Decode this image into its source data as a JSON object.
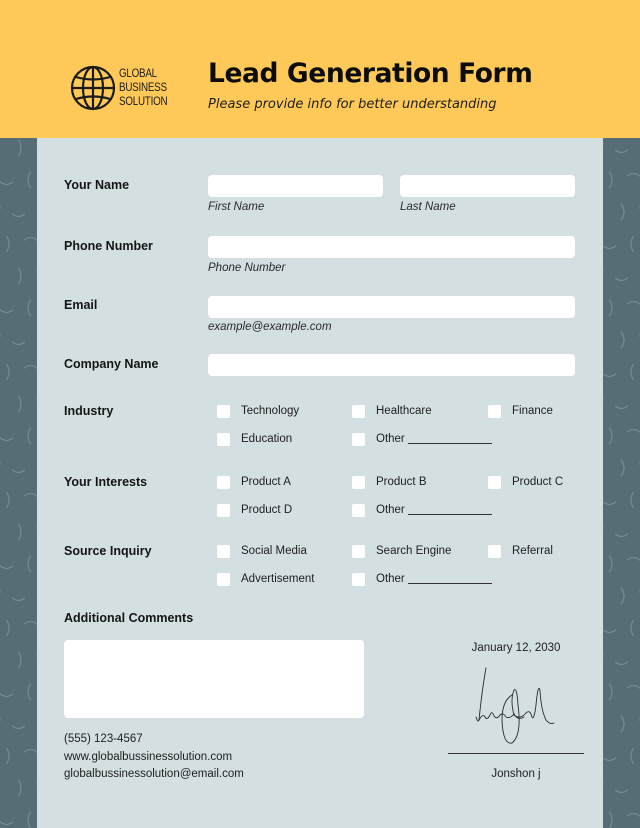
{
  "colors": {
    "header_bg": "#fec958",
    "side_bg": "#566d75",
    "paper_bg": "#d4dfe1",
    "input_bg": "#ffffff"
  },
  "header": {
    "logo_icon": "globe-icon",
    "logo_lines": [
      "GLOBAL",
      "BUSINESS",
      "SOLUTION"
    ],
    "title": "Lead Generation Form",
    "subtitle": "Please provide info for better understanding"
  },
  "form": {
    "name": {
      "label": "Your Name",
      "first": {
        "value": "",
        "hint": "First Name"
      },
      "last": {
        "value": "",
        "hint": "Last Name"
      }
    },
    "phone": {
      "label": "Phone Number",
      "value": "",
      "hint": "Phone Number"
    },
    "email": {
      "label": "Email",
      "value": "",
      "hint": "example@example.com"
    },
    "company": {
      "label": "Company Name",
      "value": ""
    },
    "industry": {
      "label": "Industry",
      "options": [
        {
          "label": "Technology",
          "checked": false
        },
        {
          "label": "Healthcare",
          "checked": false
        },
        {
          "label": "Finance",
          "checked": false
        },
        {
          "label": "Education",
          "checked": false
        },
        {
          "label": "Other",
          "checked": false
        }
      ]
    },
    "interests": {
      "label": "Your Interests",
      "options": [
        {
          "label": "Product A",
          "checked": false
        },
        {
          "label": "Product B",
          "checked": false
        },
        {
          "label": "Product C",
          "checked": false
        },
        {
          "label": "Product D",
          "checked": false
        },
        {
          "label": "Other",
          "checked": false
        }
      ]
    },
    "source": {
      "label": "Source Inquiry",
      "options": [
        {
          "label": "Social Media",
          "checked": false
        },
        {
          "label": "Search Engine",
          "checked": false
        },
        {
          "label": "Referral",
          "checked": false
        },
        {
          "label": "Advertisement",
          "checked": false
        },
        {
          "label": "Other",
          "checked": false
        }
      ]
    },
    "comments": {
      "label": "Additional Comments",
      "value": ""
    }
  },
  "footer": {
    "phone": "(555) 123-4567",
    "website": "www.globalbussinessolution.com",
    "email": "globalbussinessolution@email.com",
    "date": "January 12, 2030",
    "signature_icon": "handwritten-signature",
    "signer": "Jonshon j"
  }
}
